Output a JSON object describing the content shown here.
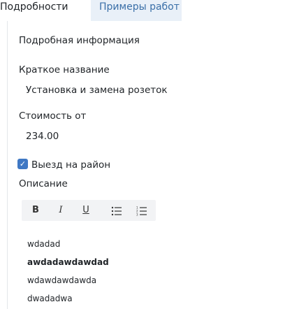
{
  "tabs": [
    {
      "label": "Подробности",
      "active": true
    },
    {
      "label": "Примеры работ",
      "active": false
    }
  ],
  "section_title": "Подробная информация",
  "fields": {
    "short_name": {
      "label": "Краткое название",
      "value": "Установка и замена розеток"
    },
    "price_from": {
      "label": "Стоимость от",
      "value": "234.00"
    },
    "travel": {
      "label": "Выезд на район",
      "checked": true
    },
    "description": {
      "label": "Описание"
    }
  },
  "editor": {
    "toolbar": {
      "bold": "B",
      "italic": "I",
      "underline": "U",
      "bullet_list_icon": "bullet-list-icon",
      "ordered_list_icon": "ordered-list-icon"
    },
    "lines": [
      {
        "text": "wdadad",
        "bold": false
      },
      {
        "text": "awdadawdawdad",
        "bold": true
      },
      {
        "text": "wdawdawdawda",
        "bold": false
      },
      {
        "text": "dwadadwa",
        "bold": false
      }
    ]
  },
  "colors": {
    "accent": "#3f78c4",
    "tab_inactive_bg": "#e9f0f8",
    "tab_inactive_text": "#3a6fa8",
    "toolbar_bg": "#f2f3f5"
  }
}
